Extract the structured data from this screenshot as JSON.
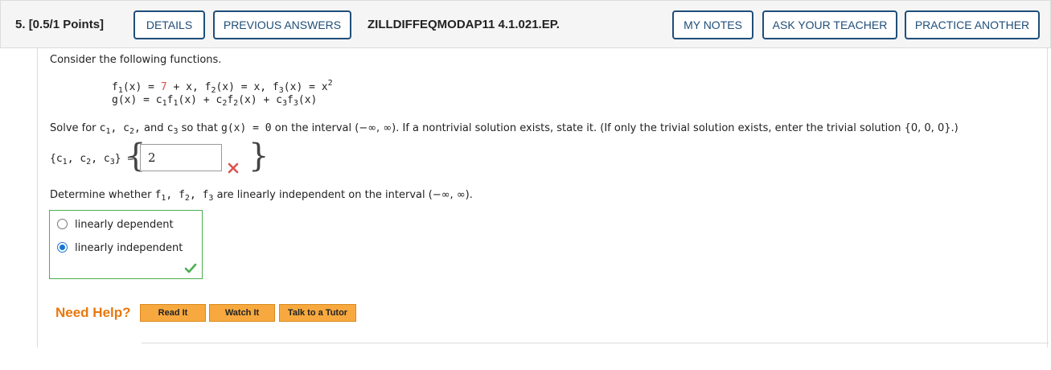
{
  "header": {
    "question_number": "5.",
    "points": "[0.5/1 Points]",
    "details_label": "DETAILS",
    "previous_answers_label": "PREVIOUS ANSWERS",
    "question_id": "ZILLDIFFEQMODAP11 4.1.021.EP.",
    "my_notes_label": "MY NOTES",
    "ask_teacher_label": "ASK YOUR TEACHER",
    "practice_another_label": "PRACTICE ANOTHER"
  },
  "problem": {
    "intro": "Consider the following functions.",
    "f1_const": "7",
    "solve_text_1": "Solve for",
    "solve_text_2": "so that",
    "solve_text_3": "on the interval (−∞, ∞). If a nontrivial solution exists, state it. (If only the trivial solution exists, enter the trivial solution {0, 0, 0}.)",
    "answer_value": "2",
    "answer_status": "incorrect",
    "determine_text": "Determine whether",
    "determine_text_2": "are linearly independent on the interval (−∞, ∞).",
    "options": [
      "linearly dependent",
      "linearly independent"
    ],
    "selected_option": "linearly independent",
    "selected_status": "correct"
  },
  "help": {
    "label": "Need Help?",
    "read_it": "Read It",
    "watch_it": "Watch It",
    "talk_tutor": "Talk to a Tutor"
  },
  "colors": {
    "button_border": "#1f4e79",
    "correct": "#4caf50",
    "incorrect": "#d9534f",
    "help_orange": "#e8780b"
  }
}
